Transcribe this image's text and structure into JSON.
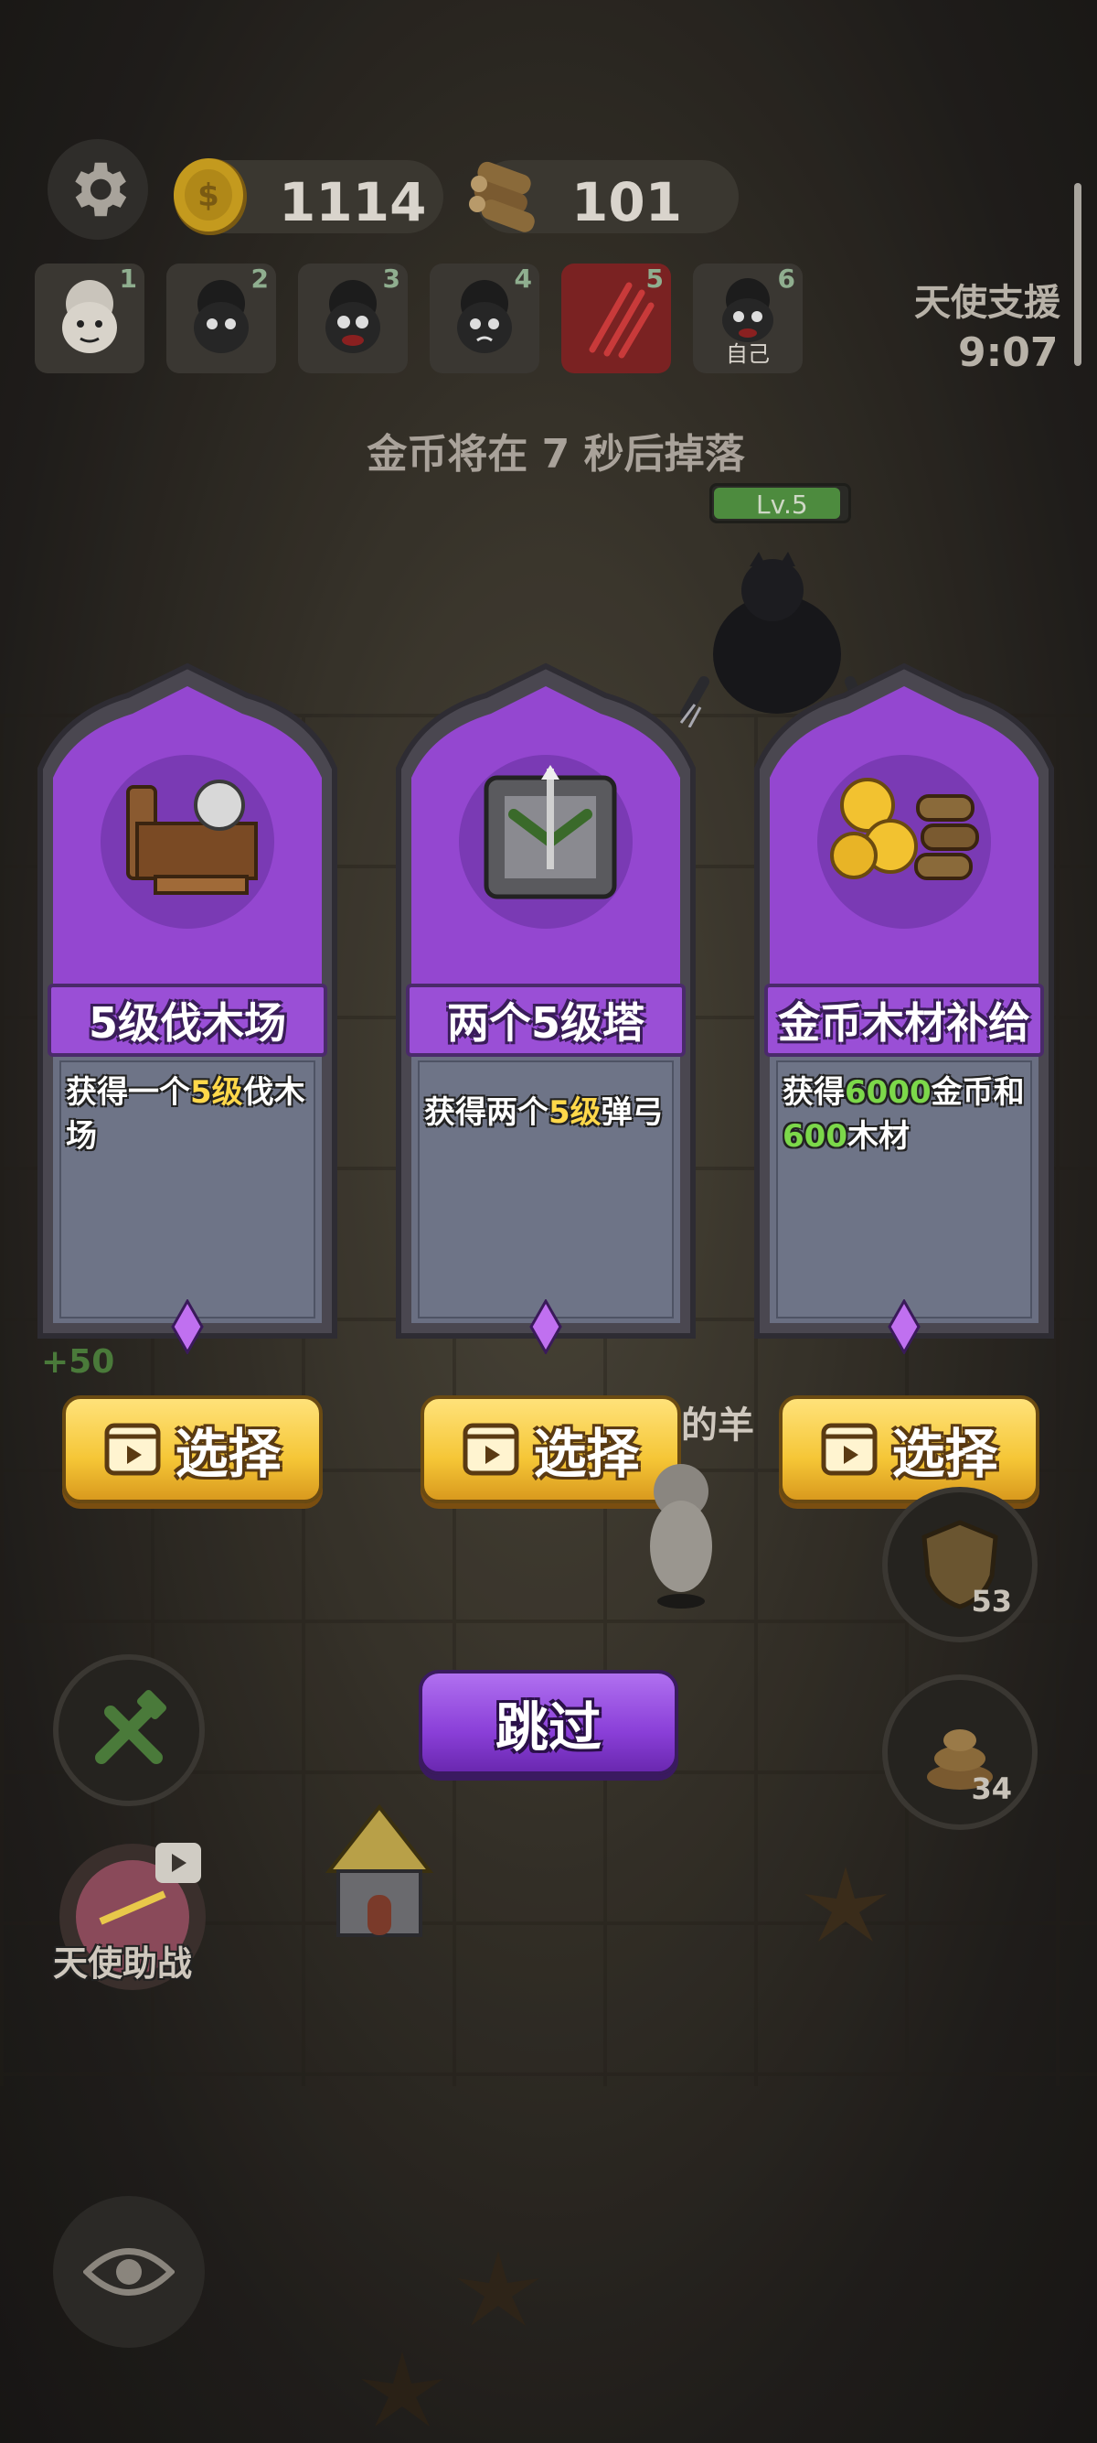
{
  "hud": {
    "coins": "1114",
    "wood": "101"
  },
  "players": [
    {
      "num": "1"
    },
    {
      "num": "2"
    },
    {
      "num": "3"
    },
    {
      "num": "4"
    },
    {
      "num": "5"
    },
    {
      "num": "6",
      "label": "自己"
    }
  ],
  "angel_support": {
    "title": "天使支援",
    "time": "9:07"
  },
  "drop_message": "金币将在 7 秒后掉落",
  "enemy": {
    "level": "Lv.5",
    "health_fraction": 0.95
  },
  "cards": [
    {
      "title": "5级伐木场",
      "desc_parts": [
        "获得一个",
        "5级",
        "伐木场"
      ],
      "art": "sawmill-icon"
    },
    {
      "title": "两个5级塔",
      "desc_parts": [
        "获得两个",
        "5级",
        "弹弓"
      ],
      "art": "crossbow-tower-icon"
    },
    {
      "title": "金币木材补给",
      "desc_parts": [
        "获得",
        "6000",
        "金币和",
        "600",
        "木材"
      ],
      "art": "coins-and-logs-icon"
    }
  ],
  "select_label": "选择",
  "skip_label": "跳过",
  "background_text": {
    "sheep_partial": "的羊",
    "plus_partial": "+50",
    "angel_help": "天使助战"
  },
  "side_buttons": {
    "shield_count": "53",
    "poop_count": "34"
  },
  "colors": {
    "card_purple": "#9a4fd6",
    "select_yellow": "#f5c636",
    "skip_purple": "#8a3fd8",
    "highlight_yellow": "#ffd84a",
    "highlight_green": "#7cd84a"
  }
}
